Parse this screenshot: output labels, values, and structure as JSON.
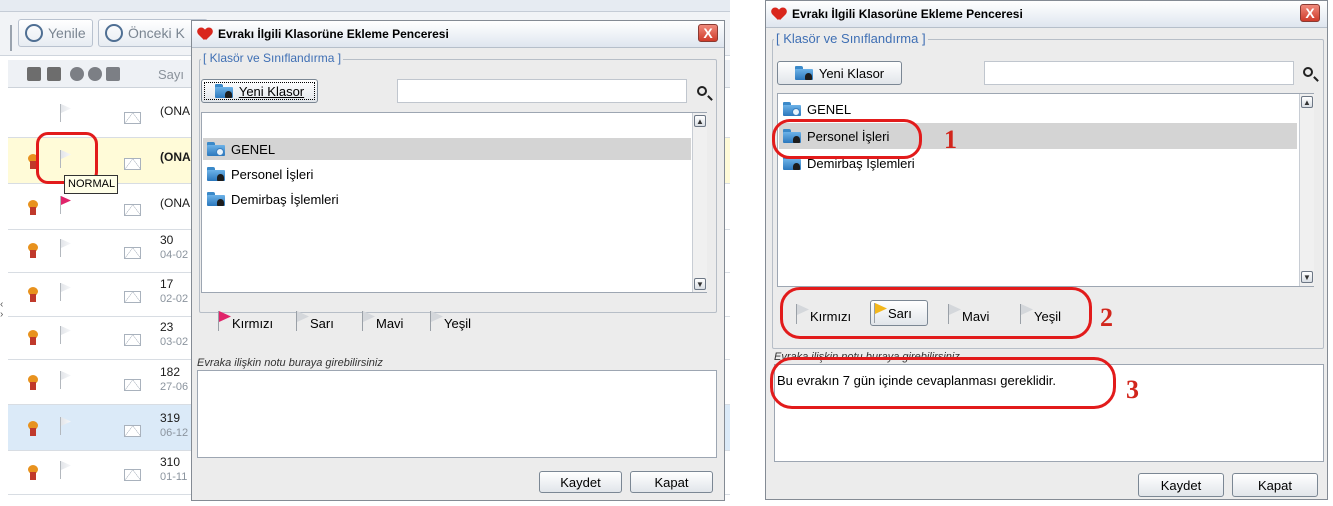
{
  "left_panel": {
    "toolbar": {
      "refresh_label": "Yenile",
      "previous_label": "Önceki K"
    },
    "column_header_partial": "Sayı",
    "rows": [
      {
        "line1": "(ONA",
        "line2": ""
      },
      {
        "line1": "(ONA",
        "line2": ""
      },
      {
        "line1": "(ONA",
        "line2": ""
      },
      {
        "line1": "30",
        "line2": "04-02"
      },
      {
        "line1": "17",
        "line2": "02-02"
      },
      {
        "line1": "23",
        "line2": "03-02"
      },
      {
        "line1": "182",
        "line2": "27-06"
      },
      {
        "line1": "319",
        "line2": "06-12"
      },
      {
        "line1": "310",
        "line2": "01-11"
      }
    ],
    "tooltip": "NORMAL"
  },
  "dialog": {
    "title": "Evrakı İlgili Klasorüne Ekleme Penceresi",
    "close_label": "X",
    "group_title": "[ Klasör ve Sınıflandırma ]",
    "new_folder_label": "Yeni Klasor",
    "search_value": "",
    "folders": [
      "GENEL",
      "Personel İşleri",
      "Demirbaş İşlemleri"
    ],
    "flags": [
      {
        "label": "Kırmızı",
        "color": "#e0246a"
      },
      {
        "label": "Sarı",
        "color": "#f3b71c"
      },
      {
        "label": "Mavi",
        "color": "#b8bcc2"
      },
      {
        "label": "Yeşil",
        "color": "#b8bcc2"
      }
    ],
    "note_label": "Evraka ilişkin notu buraya girebilirsiniz",
    "note_value": "Bu evrakın 7 gün içinde cevaplanması gereklidir.",
    "save_label": "Kaydet",
    "close_button_label": "Kapat"
  },
  "annotations": [
    "1",
    "2",
    "3"
  ]
}
